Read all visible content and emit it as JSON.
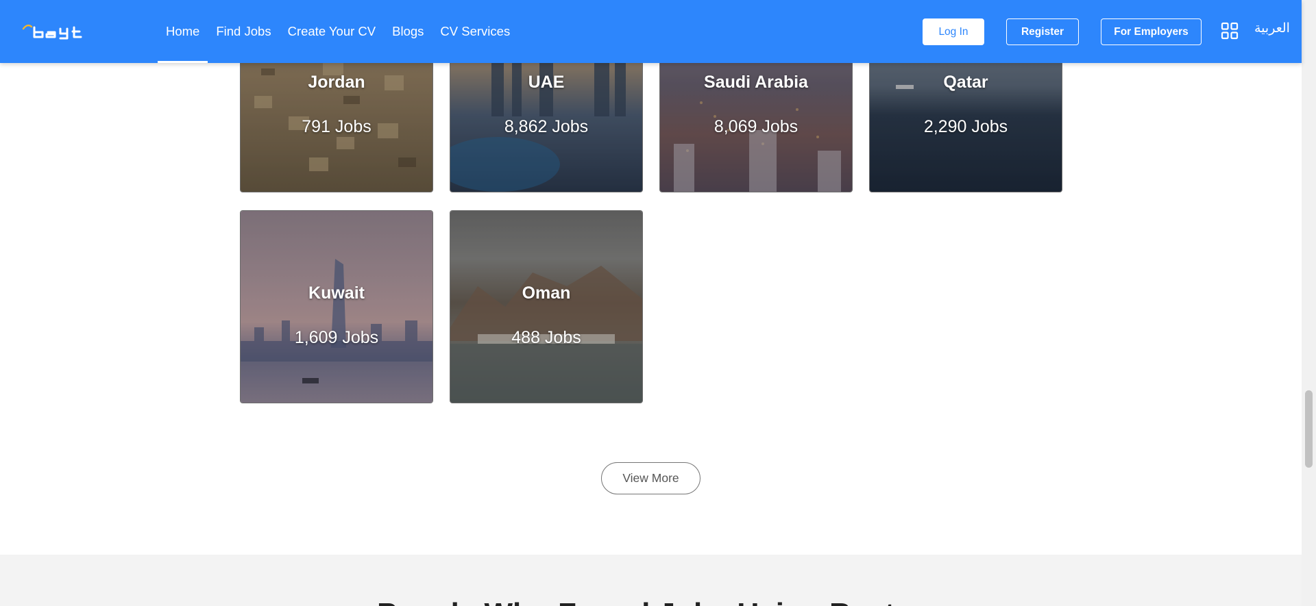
{
  "header": {
    "logo_text": "bayt",
    "nav": [
      {
        "label": "Home",
        "active": true
      },
      {
        "label": "Find Jobs"
      },
      {
        "label": "Create Your CV"
      },
      {
        "label": "Blogs"
      },
      {
        "label": "CV Services"
      }
    ],
    "login_label": "Log In",
    "register_label": "Register",
    "employers_label": "For Employers",
    "apps_icon": "grid-icon",
    "language_label": "العربية"
  },
  "countries": [
    {
      "name": "Jordan",
      "jobs": "791 Jobs"
    },
    {
      "name": "UAE",
      "jobs": "8,862 Jobs"
    },
    {
      "name": "Saudi Arabia",
      "jobs": "8,069 Jobs"
    },
    {
      "name": "Qatar",
      "jobs": "2,290 Jobs"
    },
    {
      "name": "Kuwait",
      "jobs": "1,609 Jobs"
    },
    {
      "name": "Oman",
      "jobs": "488 Jobs"
    }
  ],
  "view_more_label": "View More",
  "next_section_heading": "People Who Found Jobs Using Bayt",
  "colors": {
    "header_bg": "#2d86fc",
    "header_text": "#ffffff",
    "section_bg": "#f3f3f3"
  }
}
